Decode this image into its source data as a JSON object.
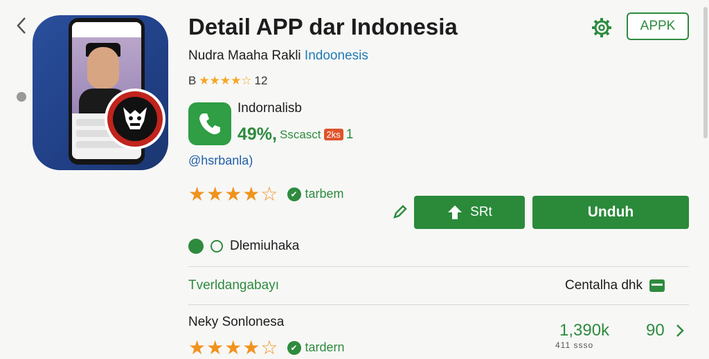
{
  "header": {
    "title": "Detail APP dar Indonesia",
    "subtitle_name": "Nudra Maaha Rakli",
    "subtitle_dev": "Indoonesis",
    "rating_prefix": "B",
    "rating_stars": "★★★★☆",
    "rating_count": "12",
    "apk_label": "APPK"
  },
  "app": {
    "name": "Indornalisb",
    "percent": "49%,",
    "percent_sub": "Sscasct",
    "tag": "2ks",
    "tag_count": "1",
    "handle": "@hsrbanla)"
  },
  "rating": {
    "stars": "★★★★☆",
    "badge_label": "tarbem"
  },
  "actions": {
    "share_label": "SRt",
    "download_label": "Unduh"
  },
  "category": {
    "label": "Dlemiuhaka"
  },
  "section": {
    "left_label": "Tverldangabayı",
    "right_label": "Centalha dhk"
  },
  "list_item": {
    "name": "Neky Sonlonesa",
    "stars": "★★★★☆",
    "badge_label": "tardern",
    "size": "1,390k",
    "size_sub": "411 ssso",
    "count": "90"
  },
  "colors": {
    "accent_green": "#2a8a3a",
    "star_orange": "#f0931e",
    "link_blue": "#1f7bb6",
    "badge_red": "#c0241d"
  },
  "icons": {
    "back": "chevron-left-icon",
    "settings": "gear-icon",
    "app": "phone-icon",
    "verified": "verified-icon",
    "edit": "pencil-icon",
    "share": "share-icon",
    "location": "location-icon",
    "card": "card-icon",
    "chevron": "chevron-right-icon"
  }
}
